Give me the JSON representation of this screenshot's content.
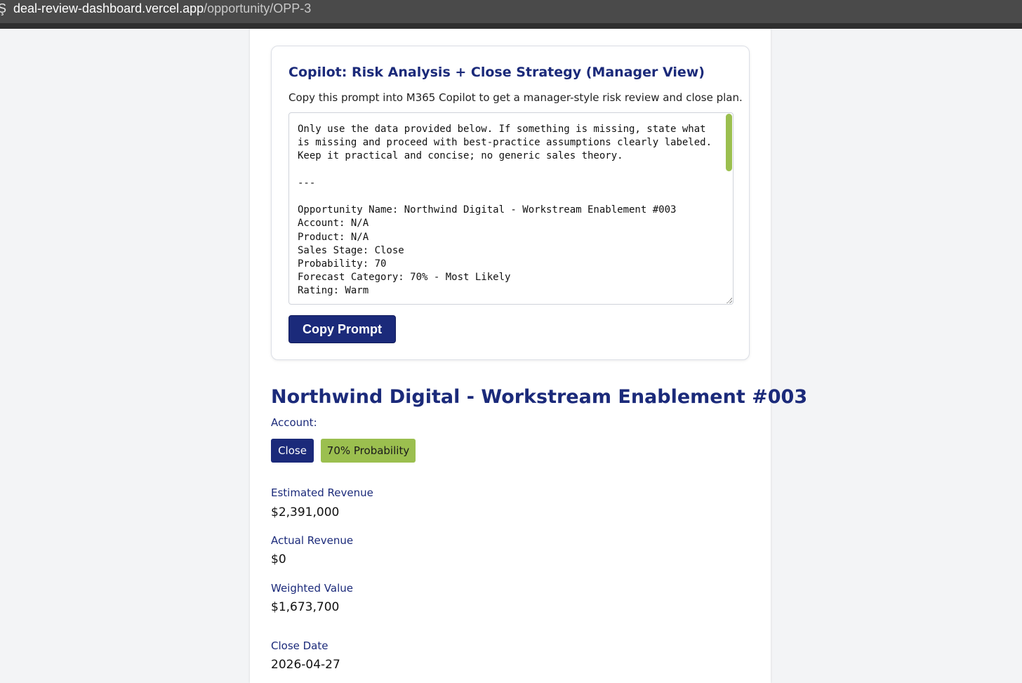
{
  "browser": {
    "url_domain": "deal-review-dashboard.vercel.app",
    "url_path": "/opportunity/OPP-3"
  },
  "copilot_card": {
    "title": "Copilot: Risk Analysis + Close Strategy (Manager View)",
    "description": "Copy this prompt into M365 Copilot to get a manager-style risk review and close plan.",
    "prompt_text": "Only use the data provided below. If something is missing, state what is missing and proceed with best-practice assumptions clearly labeled.\nKeep it practical and concise; no generic sales theory.\n\n---\n\nOpportunity Name: Northwind Digital - Workstream Enablement #003\nAccount: N/A\nProduct: N/A\nSales Stage: Close\nProbability: 70\nForecast Category: 70% - Most Likely\nRating: Warm",
    "copy_button_label": "Copy Prompt"
  },
  "opportunity": {
    "title": "Northwind Digital - Workstream Enablement #003",
    "account_label": "Account:",
    "stage_badge": "Close",
    "probability_badge": "70% Probability",
    "probability_fraction": 0.7
  },
  "metrics": {
    "estimated_revenue_label": "Estimated Revenue",
    "estimated_revenue_value": "$2,391,000",
    "actual_revenue_label": "Actual Revenue",
    "actual_revenue_value": "$0",
    "weighted_value_label": "Weighted Value",
    "weighted_value_value": "$1,673,700",
    "close_date_label": "Close Date",
    "close_date_value": "2026-04-27"
  },
  "colors": {
    "brand_navy": "#1b2a7a",
    "accent_green": "#9bbf4f",
    "page_background": "#f3f4f6"
  }
}
